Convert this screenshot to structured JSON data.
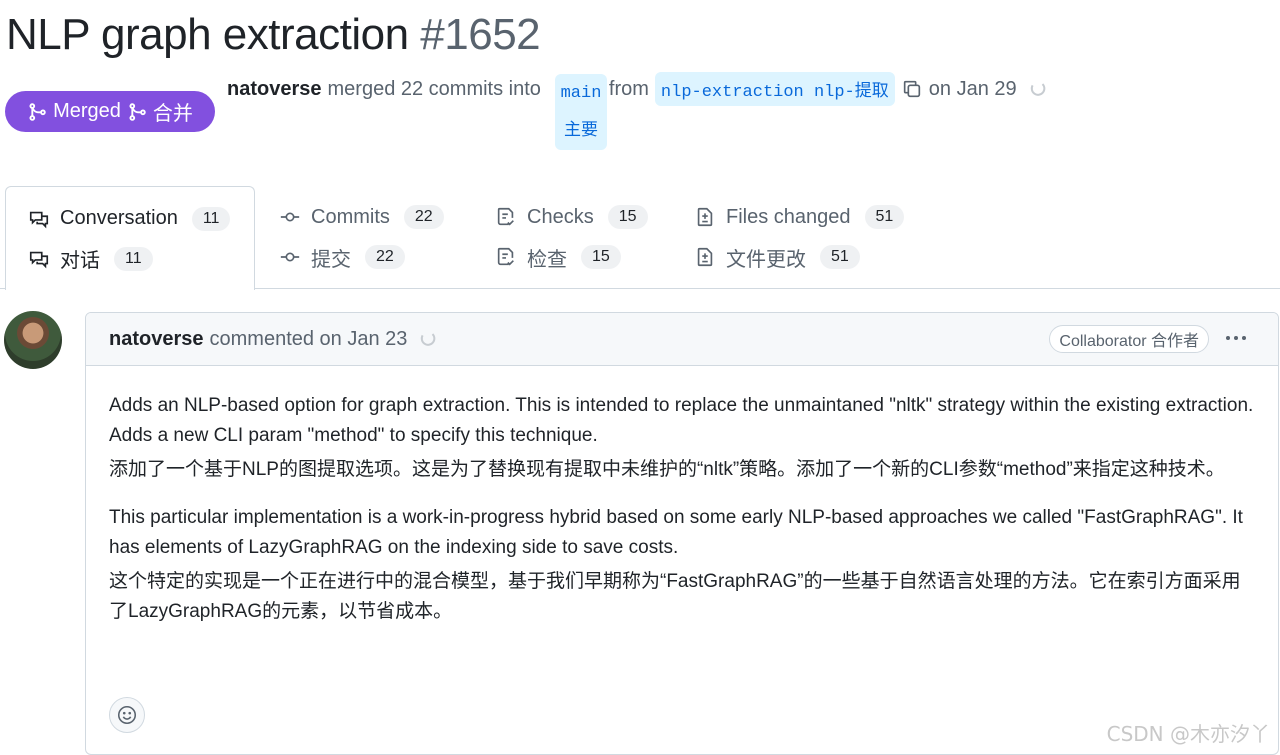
{
  "pr": {
    "title": "NLP graph extraction",
    "number": "#1652",
    "status_label": "Merged",
    "status_label_zh": "合并",
    "author": "natoverse",
    "merged_text": "merged 22 commits into",
    "base_branch": "main",
    "base_branch_zh": "主要",
    "from_text": "from",
    "head_branch": "nlp-extraction nlp-提取",
    "date_text": "on Jan 29"
  },
  "tabs": [
    {
      "label": "Conversation",
      "label_zh": "对话",
      "count": "11",
      "icon": "conversation-icon"
    },
    {
      "label": "Commits",
      "label_zh": "提交",
      "count": "22",
      "icon": "commit-icon"
    },
    {
      "label": "Checks",
      "label_zh": "检查",
      "count": "15",
      "icon": "checklist-icon"
    },
    {
      "label": "Files changed",
      "label_zh": "文件更改",
      "count": "51",
      "icon": "file-diff-icon"
    }
  ],
  "comment": {
    "author": "natoverse",
    "meta": "commented on Jan 23",
    "role": "Collaborator 合作者",
    "paragraphs": [
      {
        "en": "Adds an NLP-based option for graph extraction. This is intended to replace the unmaintaned \"nltk\" strategy within the existing extraction. Adds a new CLI param \"method\" to specify this technique.",
        "zh": "添加了一个基于NLP的图提取选项。这是为了替换现有提取中未维护的“nltk”策略。添加了一个新的CLI参数“method”来指定这种技术。"
      },
      {
        "en": "This particular implementation is a work-in-progress hybrid based on some early NLP-based approaches we called \"FastGraphRAG\". It has elements of LazyGraphRAG on the indexing side to save costs.",
        "zh": "这个特定的实现是一个正在进行中的混合模型，基于我们早期称为“FastGraphRAG”的一些基于自然语言处理的方法。它在索引方面采用了LazyGraphRAG的元素，以节省成本。"
      }
    ]
  },
  "watermark": "CSDN @木亦汐丫",
  "colors": {
    "merged": "#8250df",
    "branch_bg": "#ddf4ff",
    "branch_text": "#0969da"
  }
}
